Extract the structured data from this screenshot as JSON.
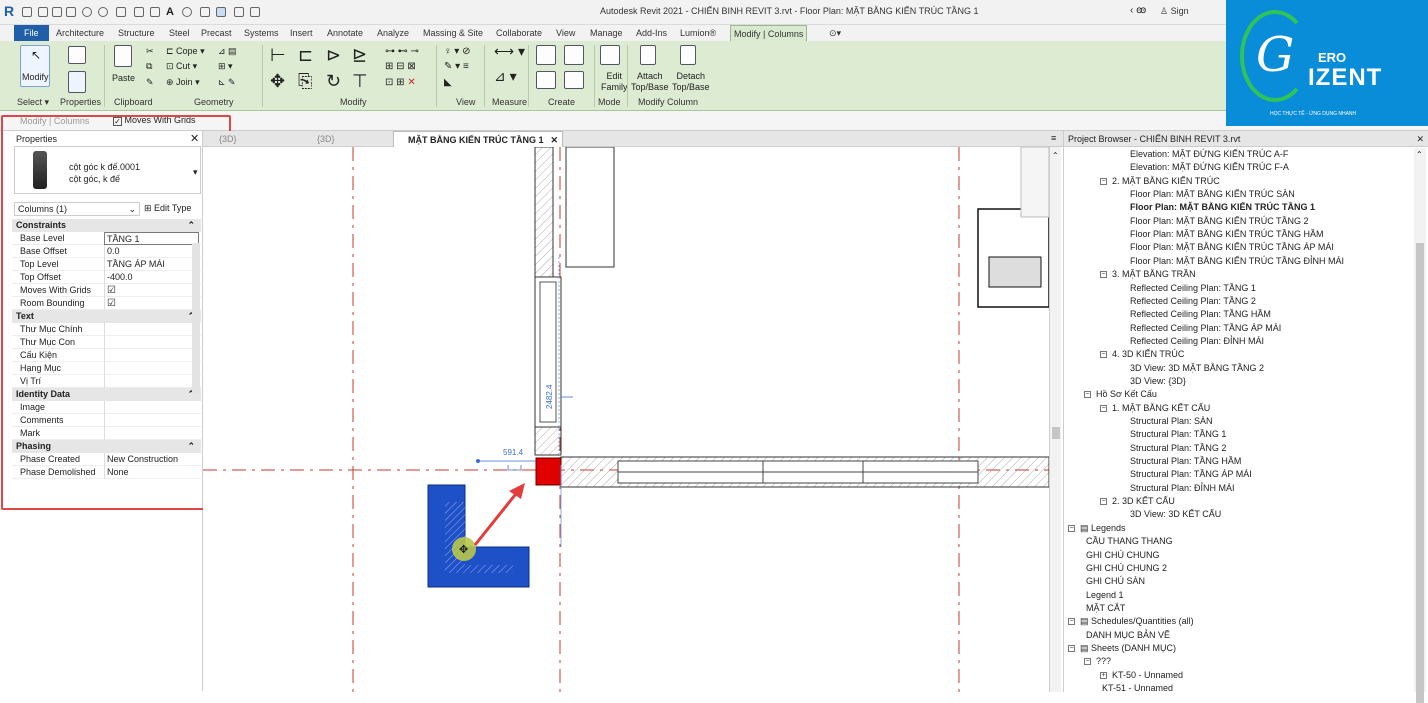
{
  "app": {
    "title": "Autodesk Revit 2021 - CHIẾN BINH REVIT 3.rvt - Floor Plan: MẶT BẰNG KIẾN TRÚC TẦNG 1",
    "sign_in": "Sign"
  },
  "tabs": [
    "File",
    "Architecture",
    "Structure",
    "Steel",
    "Precast",
    "Systems",
    "Insert",
    "Annotate",
    "Analyze",
    "Massing & Site",
    "Collaborate",
    "View",
    "Manage",
    "Add-Ins",
    "Lumion®",
    "Modify | Columns"
  ],
  "ribbon": {
    "modify": "Modify",
    "paste": "Paste",
    "cope": "Cope",
    "cut": "Cut",
    "join": "Join",
    "edit_family": [
      "Edit",
      "Family"
    ],
    "attach": [
      "Attach",
      "Top/Base"
    ],
    "detach": [
      "Detach",
      "Top/Base"
    ],
    "panels": {
      "select": "Select",
      "properties": "Properties",
      "clipboard": "Clipboard",
      "geometry": "Geometry",
      "modify": "Modify",
      "view": "View",
      "measure": "Measure",
      "create": "Create",
      "mode": "Mode",
      "modify_column": "Modify Column"
    }
  },
  "options_bar": {
    "context": "Modify | Columns",
    "moves_with_grids": "Moves With Grids"
  },
  "properties": {
    "title": "Properties",
    "type_name_1": "cột góc k đế.0001",
    "type_name_2": "cột góc, k đế",
    "selector": "Columns (1)",
    "edit_type": "Edit Type",
    "groups": [
      {
        "name": "Constraints",
        "rows": [
          {
            "k": "Base Level",
            "v": "TẦNG 1"
          },
          {
            "k": "Base Offset",
            "v": "0.0"
          },
          {
            "k": "Top Level",
            "v": "TẦNG ÁP MÁI"
          },
          {
            "k": "Top Offset",
            "v": "-400.0"
          },
          {
            "k": "Moves With Grids",
            "v": "☑"
          },
          {
            "k": "Room Bounding",
            "v": "☑"
          }
        ]
      },
      {
        "name": "Text",
        "rows": [
          {
            "k": "Thư Mục Chính",
            "v": ""
          },
          {
            "k": "Thư Mục Con",
            "v": ""
          },
          {
            "k": "Cấu Kiện",
            "v": ""
          },
          {
            "k": "Hạng Mục",
            "v": ""
          },
          {
            "k": "Vị Trí",
            "v": ""
          }
        ]
      },
      {
        "name": "Identity Data",
        "rows": [
          {
            "k": "Image",
            "v": ""
          },
          {
            "k": "Comments",
            "v": ""
          },
          {
            "k": "Mark",
            "v": ""
          }
        ]
      },
      {
        "name": "Phasing",
        "rows": [
          {
            "k": "Phase Created",
            "v": "New Construction"
          },
          {
            "k": "Phase Demolished",
            "v": "None"
          }
        ]
      }
    ]
  },
  "view_tabs": [
    "{3D}",
    "{3D}",
    "MẶT BẰNG KIẾN TRÚC TẦNG 1"
  ],
  "canvas": {
    "dim_horizontal": "591.4",
    "dim_vertical": "2482.4"
  },
  "browser": {
    "title": "Project Browser - CHIẾN BINH REVIT 3.rvt",
    "items": [
      {
        "t": "Elevation: MẶT ĐỨNG KIẾN TRÚC A-F",
        "l": 4
      },
      {
        "t": "Elevation: MẶT ĐỨNG KIẾN TRÚC F-A",
        "l": 4
      },
      {
        "t": "2. MẶT BẰNG KIẾN TRÚC",
        "l": 3,
        "g": "−"
      },
      {
        "t": "Floor Plan: MẶT BẰNG KIẾN TRÚC SÀN",
        "l": 4
      },
      {
        "t": "Floor Plan: MẶT BẰNG KIẾN TRÚC TẦNG 1",
        "l": 4,
        "sel": true
      },
      {
        "t": "Floor Plan: MẶT BẰNG KIẾN TRÚC TẦNG 2",
        "l": 4
      },
      {
        "t": "Floor Plan: MẶT BẰNG KIẾN TRÚC TẦNG HẦM",
        "l": 4
      },
      {
        "t": "Floor Plan: MẶT BẰNG KIẾN TRÚC TẦNG ÁP MÁI",
        "l": 4
      },
      {
        "t": "Floor Plan: MẶT BẰNG KIẾN TRÚC TẦNG ĐỈNH MÁI",
        "l": 4
      },
      {
        "t": "3. MẶT BẰNG TRẦN",
        "l": 3,
        "g": "−"
      },
      {
        "t": "Reflected Ceiling Plan: TẦNG 1",
        "l": 4
      },
      {
        "t": "Reflected Ceiling Plan: TẦNG 2",
        "l": 4
      },
      {
        "t": "Reflected Ceiling Plan: TẦNG HẦM",
        "l": 4
      },
      {
        "t": "Reflected Ceiling Plan: TẦNG ÁP MÁI",
        "l": 4
      },
      {
        "t": "Reflected Ceiling Plan: ĐỈNH MÁI",
        "l": 4
      },
      {
        "t": "4. 3D KIẾN TRÚC",
        "l": 3,
        "g": "−"
      },
      {
        "t": "3D View: 3D MẶT BẰNG TẦNG 2",
        "l": 4
      },
      {
        "t": "3D View: {3D}",
        "l": 4
      },
      {
        "t": "Hồ Sơ Kết Cấu",
        "l": 2,
        "g": "−"
      },
      {
        "t": "1. MẶT BẰNG KẾT CẤU",
        "l": 3,
        "g": "−"
      },
      {
        "t": "Structural Plan: SÀN",
        "l": 4
      },
      {
        "t": "Structural Plan: TẦNG 1",
        "l": 4
      },
      {
        "t": "Structural Plan: TẦNG 2",
        "l": 4
      },
      {
        "t": "Structural Plan: TẦNG HẦM",
        "l": 4
      },
      {
        "t": "Structural Plan: TẦNG ÁP MÁI",
        "l": 4
      },
      {
        "t": "Structural Plan: ĐỈNH MÁI",
        "l": 4
      },
      {
        "t": "2. 3D KẾT CẤU",
        "l": 3,
        "g": "−"
      },
      {
        "t": "3D View: 3D KẾT CẤU",
        "l": 4
      },
      {
        "t": "Legends",
        "l": 1,
        "g": "−",
        "icon": true
      },
      {
        "t": "CẦU THANG THANG",
        "l": 2
      },
      {
        "t": "GHI CHÚ CHUNG",
        "l": 2
      },
      {
        "t": "GHI CHÚ CHUNG 2",
        "l": 2
      },
      {
        "t": "GHI CHÚ SÀN",
        "l": 2
      },
      {
        "t": "Legend 1",
        "l": 2
      },
      {
        "t": "MẶT CẮT",
        "l": 2
      },
      {
        "t": "Schedules/Quantities (all)",
        "l": 1,
        "g": "−",
        "icon": true
      },
      {
        "t": "DANH MỤC BẢN VẼ",
        "l": 2
      },
      {
        "t": "Sheets (DANH MỤC)",
        "l": 1,
        "g": "−",
        "icon": true
      },
      {
        "t": "???",
        "l": 2,
        "g": "−"
      },
      {
        "t": "KT-50 - Unnamed",
        "l": 3,
        "g": "+"
      },
      {
        "t": "KT-51 - Unnamed",
        "l": 3
      }
    ]
  },
  "logo": {
    "line1": "ERO",
    "line2": "IZENT",
    "tagline": "HỌC THỰC TẾ - ỨNG DỤNG NHANH"
  },
  "colors": {
    "file_tab": "#1f5fa8",
    "ribbon": "#ddebd2",
    "highlight_box": "#e14646",
    "column_fill": "#1e50c8",
    "arrow": "#e33c3c",
    "logo_bg": "#0a8dd9"
  }
}
